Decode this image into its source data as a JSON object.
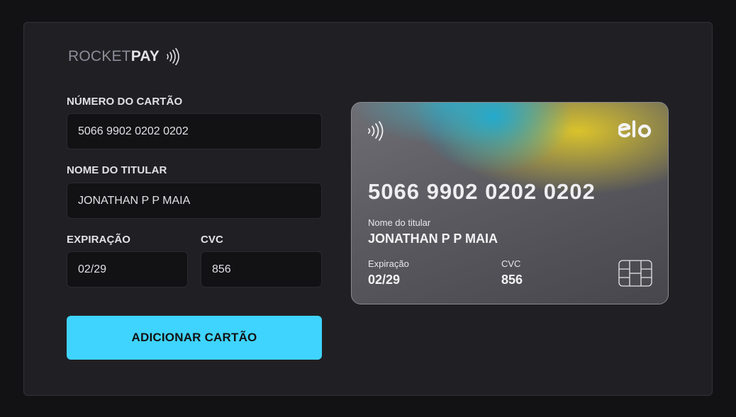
{
  "brand": {
    "rocket": "ROCKET",
    "pay": "PAY",
    "icon": "contactless-icon"
  },
  "form": {
    "number_label": "NÚMERO DO CARTÃO",
    "number_value": "5066 9902 0202 0202",
    "name_label": "NOME DO TITULAR",
    "name_value": "JONATHAN P P MAIA",
    "expiry_label": "EXPIRAÇÃO",
    "expiry_value": "02/29",
    "cvc_label": "CVC",
    "cvc_value": "856",
    "submit_label": "ADICIONAR CARTÃO"
  },
  "card": {
    "brand_logo": "elo",
    "number": "5066 9902 0202 0202",
    "holder_label": "Nome do titular",
    "holder": "JONATHAN P P MAIA",
    "expiry_label": "Expiração",
    "expiry": "02/29",
    "cvc_label": "CVC",
    "cvc": "856",
    "icons": [
      "contactless-icon",
      "elo-logo",
      "chip-icon"
    ]
  },
  "colors": {
    "background": "#121214",
    "panel": "#202024",
    "input": "#121214",
    "accent": "#3fd4fd"
  }
}
